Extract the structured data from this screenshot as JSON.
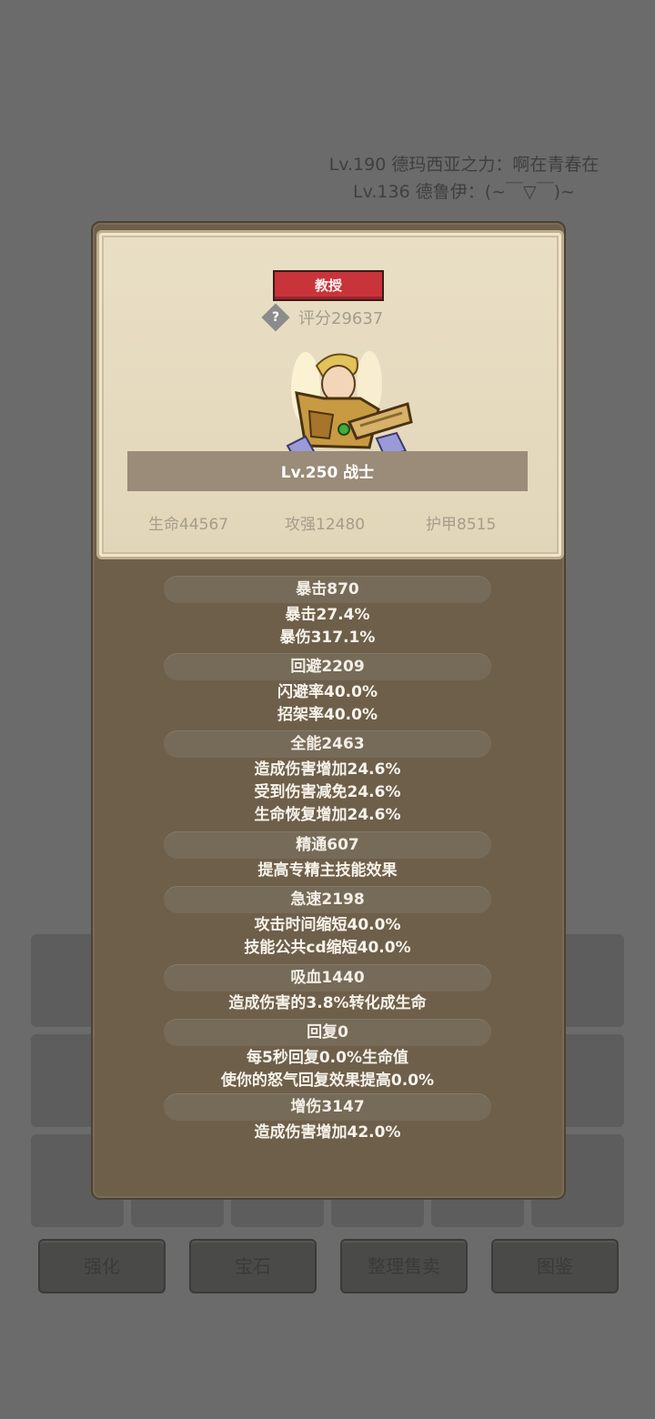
{
  "background": {
    "log_lines": [
      "Lv.190 德玛西亚之力：啊在青春在",
      "Lv.136 德鲁伊：(~￣▽￣)~"
    ],
    "buttons": [
      "强化",
      "宝石",
      "整理售卖",
      "图鉴"
    ]
  },
  "card": {
    "rank": "教授",
    "score": "评分29637",
    "help_icon_label": "?",
    "hero_name": "Lv.250 战士",
    "stats": {
      "hp": "生命44567",
      "attack": "攻强12480",
      "armor": "护甲8515"
    }
  },
  "attributes": [
    {
      "title": "暴击870",
      "lines": [
        "暴击27.4%",
        "暴伤317.1%"
      ]
    },
    {
      "title": "回避2209",
      "lines": [
        "闪避率40.0%",
        "招架率40.0%"
      ]
    },
    {
      "title": "全能2463",
      "lines": [
        "造成伤害增加24.6%",
        "受到伤害减免24.6%",
        "生命恢复增加24.6%"
      ]
    },
    {
      "title": "精通607",
      "lines": [
        "提高专精主技能效果"
      ]
    },
    {
      "title": "急速2198",
      "lines": [
        "攻击时间缩短40.0%",
        "技能公共cd缩短40.0%"
      ]
    },
    {
      "title": "吸血1440",
      "lines": [
        "造成伤害的3.8%转化成生命"
      ]
    },
    {
      "title": "回复0",
      "lines": [
        "每5秒回复0.0%生命值",
        "使你的怒气回复效果提高0.0%"
      ]
    },
    {
      "title": "增伤3147",
      "lines": [
        "造成伤害增加42.0%"
      ]
    }
  ],
  "colors": {
    "rank_badge": "#c8343a",
    "panel": "#6e5f4b",
    "card": "#e6dbbf"
  }
}
